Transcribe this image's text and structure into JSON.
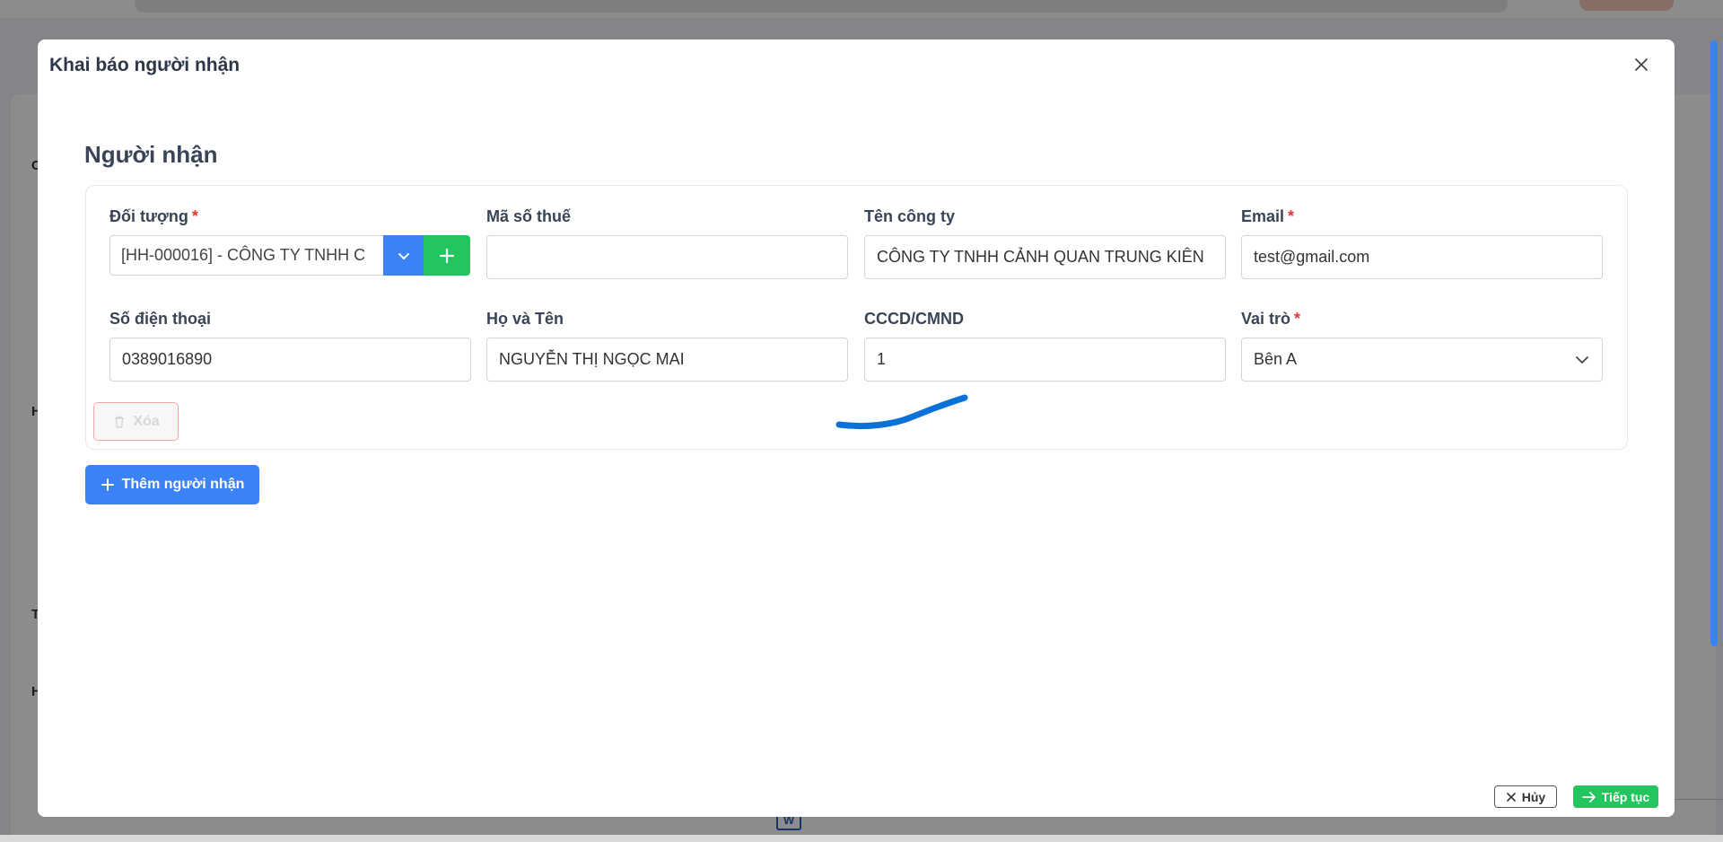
{
  "modal": {
    "title": "Khai báo người nhận"
  },
  "section": {
    "title": "Người nhận"
  },
  "fields": {
    "doi_tuong": {
      "label": "Đối tượng",
      "required_mark": "*",
      "value": "[HH-000016] - CÔNG TY TNHH C"
    },
    "ma_so_thue": {
      "label": "Mã số thuế",
      "value": ""
    },
    "ten_cong_ty": {
      "label": "Tên công ty",
      "value": "CÔNG TY TNHH CẢNH QUAN TRUNG KIÊN"
    },
    "email": {
      "label": "Email",
      "required_mark": "*",
      "value": "test@gmail.com"
    },
    "so_dien_thoai": {
      "label": "Số điện thoại",
      "value": "0389016890"
    },
    "ho_va_ten": {
      "label": "Họ và Tên",
      "value": "NGUYỄN THỊ NGỌC MAI"
    },
    "cccd": {
      "label": "CCCD/CMND",
      "value": "1"
    },
    "vai_tro": {
      "label": "Vai trò",
      "required_mark": "*",
      "value": "Bên A"
    }
  },
  "buttons": {
    "delete": "Xóa",
    "add_recipient": "Thêm người nhận",
    "cancel": "Hủy",
    "continue": "Tiếp tục"
  },
  "background": {
    "letters": [
      "C",
      "H",
      "T",
      "H"
    ]
  },
  "colors": {
    "primary": "#3b82f6",
    "success": "#22c55e",
    "danger": "#e53935",
    "pen": "#0a72d6"
  },
  "icons": {
    "close": "close-icon",
    "chevron_down": "chevron-down-icon",
    "plus": "plus-icon",
    "trash": "trash-icon",
    "arrow_right": "arrow-right-icon"
  }
}
